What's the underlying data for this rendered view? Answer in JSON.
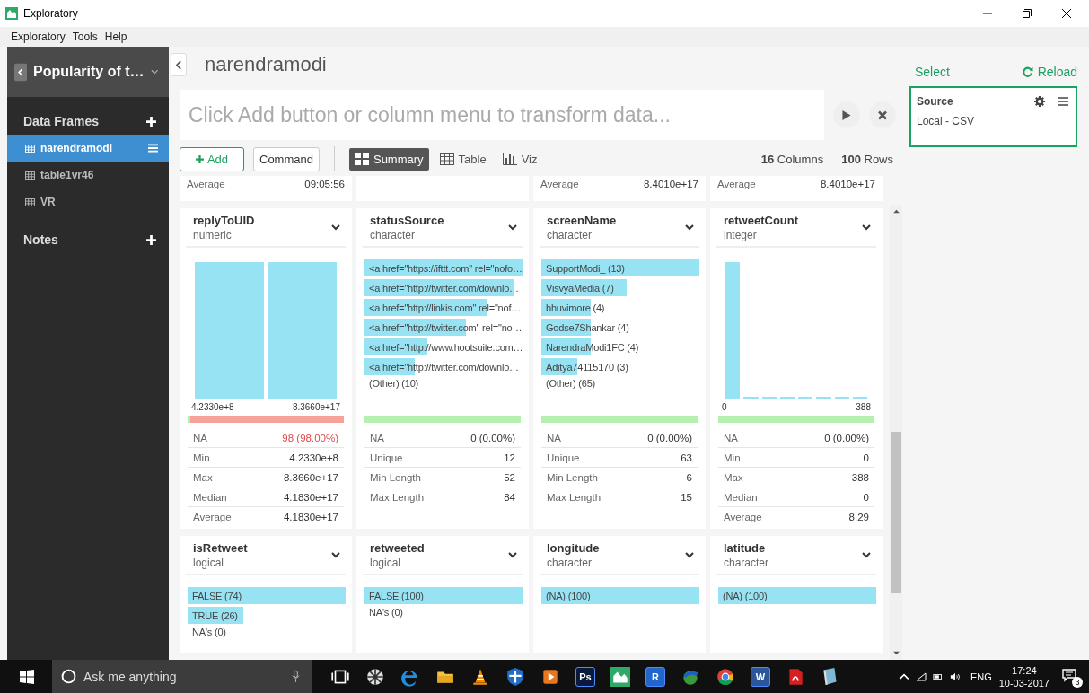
{
  "window": {
    "title": "Exploratory"
  },
  "menu": [
    "Exploratory",
    "Tools",
    "Help"
  ],
  "sidebar": {
    "project": "Popularity of t…",
    "sections": [
      {
        "title": "Data Frames",
        "items": [
          {
            "label": "narendramodi",
            "selected": true
          },
          {
            "label": "table1vr46",
            "selected": false
          },
          {
            "label": "VR",
            "selected": false
          }
        ]
      },
      {
        "title": "Notes"
      }
    ]
  },
  "header": {
    "title": "narendramodi",
    "command_placeholder": "Click Add button or column menu to transform data..."
  },
  "toolbar": {
    "add": "Add",
    "command": "Command",
    "views": [
      {
        "label": "Summary",
        "kind": "summary",
        "selected": true
      },
      {
        "label": "Table",
        "kind": "table",
        "selected": false
      },
      {
        "label": "Viz",
        "kind": "viz",
        "selected": false
      }
    ],
    "columns": "**16** Columns",
    "rows": "**100** Rows"
  },
  "partial_cards": [
    {
      "kind": "stat",
      "label": "Average",
      "value": "09:05:56"
    },
    {
      "kind": "blank"
    },
    {
      "kind": "stat",
      "label": "Average",
      "value": "8.4010e+17"
    },
    {
      "kind": "stat",
      "label": "Average",
      "value": "8.4010e+17"
    }
  ],
  "cards": [
    {
      "name": "replyToUID",
      "type": "numeric",
      "kind": "histogram",
      "axis_min": "4.2330e+8",
      "axis_max": "8.3660e+17",
      "na_bar": {
        "level": 0.98
      },
      "na": {
        "label": "NA",
        "value": "98 (98.00%)",
        "alert": true
      },
      "stats": [
        {
          "label": "Min",
          "value": "4.2330e+8"
        },
        {
          "label": "Max",
          "value": "8.3660e+17"
        },
        {
          "label": "Median",
          "value": "4.1830e+17"
        },
        {
          "label": "Average",
          "value": "4.1830e+17"
        }
      ]
    },
    {
      "name": "statusSource",
      "type": "character",
      "kind": "top_values",
      "values": [
        {
          "label": "<a href=\"https://ifttt.com\" rel=\"nofo…"
        },
        {
          "label": "<a href=\"http://twitter.com/downlo…"
        },
        {
          "label": "<a href=\"http://linkis.com\" rel=\"nof…"
        },
        {
          "label": "<a href=\"http://twitter.com\" rel=\"no…"
        },
        {
          "label": "<a href=\"http://www.hootsuite.com…"
        },
        {
          "label": "<a href=\"http://twitter.com/downlo…"
        }
      ],
      "other": "(Other) (10)",
      "na": {
        "label": "NA",
        "value": "0 (0.00%)",
        "alert": false
      },
      "stats": [
        {
          "label": "Unique",
          "value": "12"
        },
        {
          "label": "Min Length",
          "value": "52"
        },
        {
          "label": "Max Length",
          "value": "84"
        }
      ]
    },
    {
      "name": "screenName",
      "type": "character",
      "kind": "top_values",
      "values": [
        {
          "label": "SupportModi_ (13)"
        },
        {
          "label": "VisvyaMedia (7)"
        },
        {
          "label": "bhuvimore (4)"
        },
        {
          "label": "Godse7Shankar (4)"
        },
        {
          "label": "NarendraModi1FC (4)"
        },
        {
          "label": "Aditya74115170 (3)"
        }
      ],
      "other": "(Other) (65)",
      "na": {
        "label": "NA",
        "value": "0 (0.00%)",
        "alert": false
      },
      "stats": [
        {
          "label": "Unique",
          "value": "63"
        },
        {
          "label": "Min Length",
          "value": "6"
        },
        {
          "label": "Max Length",
          "value": "15"
        }
      ]
    },
    {
      "name": "retweetCount",
      "type": "integer",
      "kind": "histogram",
      "axis_min": "0",
      "axis_max": "388",
      "na": {
        "label": "NA",
        "value": "0 (0.00%)",
        "alert": false
      },
      "stats": [
        {
          "label": "Min",
          "value": "0"
        },
        {
          "label": "Max",
          "value": "388"
        },
        {
          "label": "Median",
          "value": "0"
        },
        {
          "label": "Average",
          "value": "8.29"
        }
      ]
    },
    {
      "name": "isRetweet",
      "type": "logical",
      "kind": "top_values",
      "values": [
        {
          "label": "FALSE (74)"
        },
        {
          "label": "TRUE (26)"
        }
      ],
      "other": "NA's (0)"
    },
    {
      "name": "retweeted",
      "type": "logical",
      "kind": "top_values",
      "values": [
        {
          "label": "FALSE (100)"
        }
      ],
      "other": "NA's (0)"
    },
    {
      "name": "longitude",
      "type": "character",
      "kind": "top_values",
      "values": [
        {
          "label": "(NA) (100)"
        }
      ]
    },
    {
      "name": "latitude",
      "type": "character",
      "kind": "top_values",
      "values": [
        {
          "label": "(NA) (100)"
        }
      ]
    }
  ],
  "right_panel": {
    "select": "Select",
    "reload": "Reload",
    "step": {
      "title": "Source",
      "subtitle": "Local - CSV"
    }
  },
  "taskbar": {
    "search_placeholder": "Ask me anything",
    "apps": [
      {
        "kind": "task_view"
      },
      {
        "kind": "pinwheel"
      },
      {
        "kind": "browser"
      },
      {
        "kind": "folder"
      },
      {
        "kind": "cone"
      },
      {
        "kind": "shield"
      },
      {
        "kind": "player"
      },
      {
        "kind": "lettered",
        "label": "Ps",
        "color": "#0b1a3a"
      },
      {
        "kind": "chart"
      },
      {
        "kind": "lettered",
        "label": "R",
        "color": "#2266cc"
      },
      {
        "kind": "globe"
      },
      {
        "kind": "ring"
      },
      {
        "kind": "lettered",
        "label": "W",
        "color": "#2b579a"
      },
      {
        "kind": "pdf"
      },
      {
        "kind": "book"
      }
    ],
    "language": "ENG",
    "time": "17:24",
    "date": "10-03-2017",
    "notifications": "3"
  }
}
